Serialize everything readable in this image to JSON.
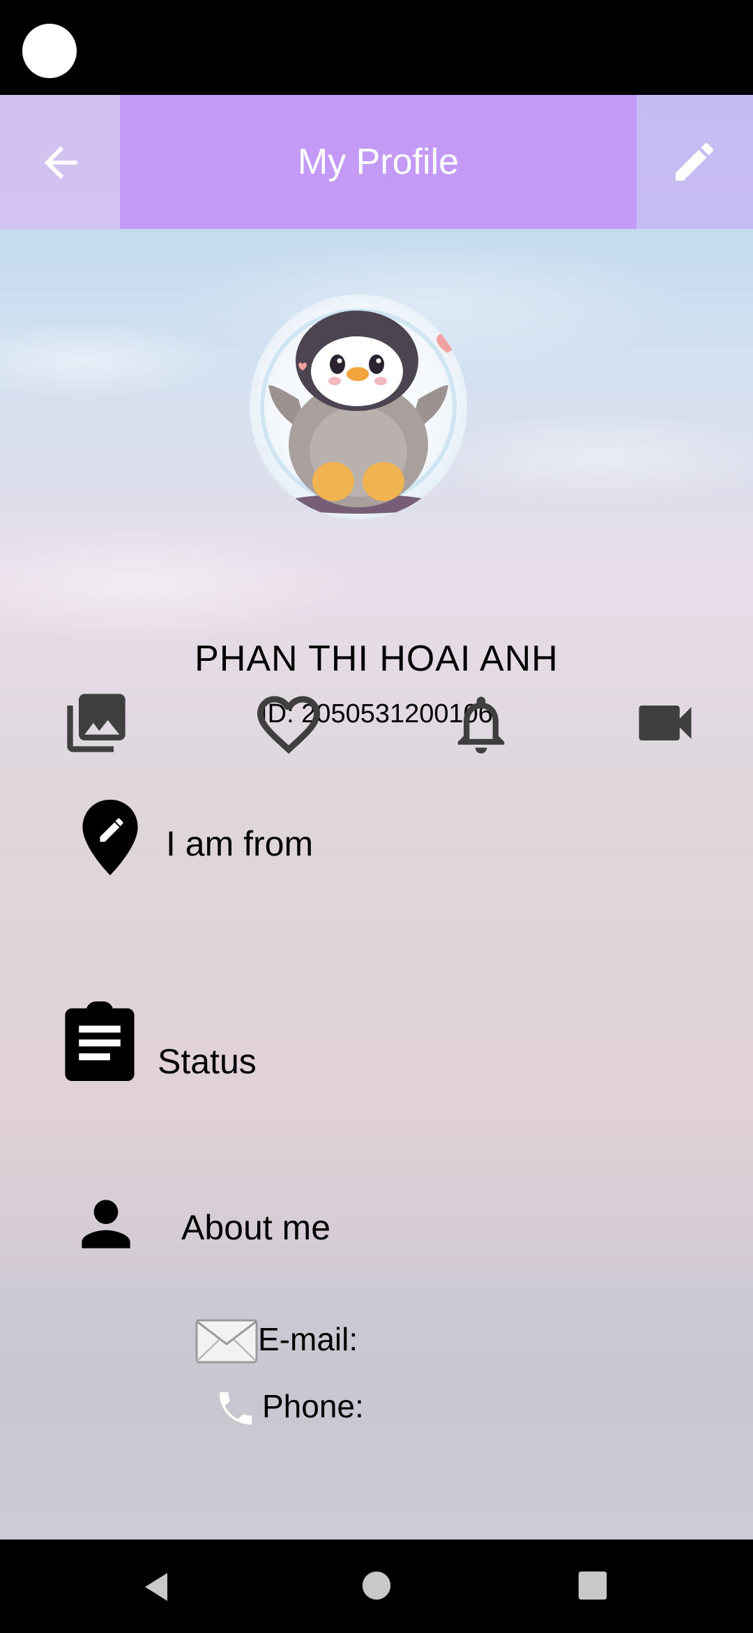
{
  "header": {
    "title": "My Profile",
    "back_icon": "arrow-back-icon",
    "edit_icon": "pencil-icon",
    "accent_color": "#c39bf7"
  },
  "profile": {
    "name": "PHAN THI HOAI ANH",
    "id_text": "ID: 2050531200106",
    "avatar": "penguin-avatar"
  },
  "actions": [
    {
      "icon": "photo-library-icon"
    },
    {
      "icon": "heart-outline-icon"
    },
    {
      "icon": "bell-icon"
    },
    {
      "icon": "videocam-icon"
    }
  ],
  "info": {
    "from_label": "I am from",
    "status_label": "Status",
    "about_label": "About me",
    "email_label": "E-mail:",
    "phone_label": "Phone:"
  },
  "nav": [
    "back-triangle-icon",
    "home-circle-icon",
    "recents-square-icon"
  ]
}
